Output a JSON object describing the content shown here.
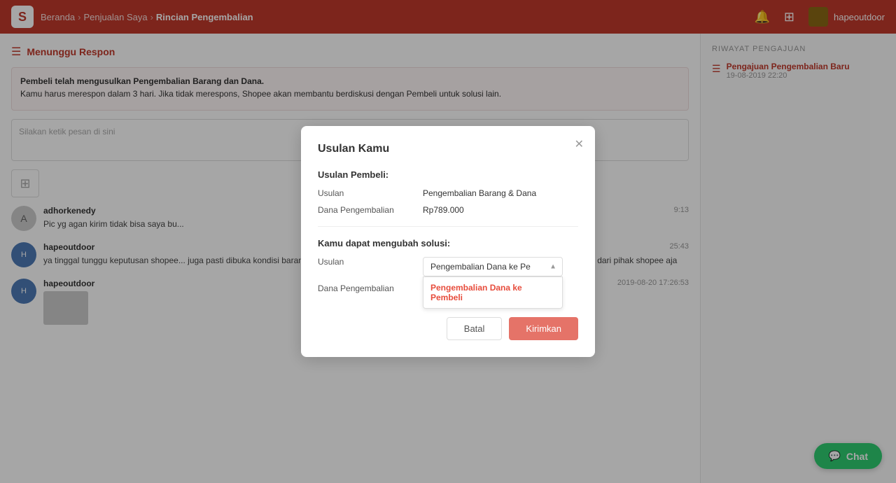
{
  "topnav": {
    "logo": "S",
    "breadcrumb": [
      {
        "label": "Beranda",
        "current": false
      },
      {
        "label": "Penjualan Saya",
        "current": false
      },
      {
        "label": "Rincian Pengembalian",
        "current": true
      }
    ],
    "user": "hapeoutdoor"
  },
  "left": {
    "status_icon": "☰",
    "status_title": "Menunggu Respon",
    "info_title": "Pembeli telah mengusulkan Pengembalian Barang dan Dana.",
    "info_body": "Kamu harus merespon dalam 3 hari. Jika tidak merespons, Shopee akan membantu berdiskusi dengan Pembeli untuk solusi lain.",
    "message_placeholder": "Silakan ketik pesan di sini",
    "comments": [
      {
        "author": "adhorkenedy",
        "time": "9:13",
        "text": "Pic yg agan kirim tidak bisa saya bu...",
        "has_image": false
      },
      {
        "author": "hapeoutdoor",
        "time": "25:43",
        "text": "ya tinggal tunggu keputusan shopee... juga pasti dibuka kondisi barang. em... malfungsi kok minta pengembalian barang dan dana. tunggu resolving dari pihak shopee aja",
        "has_image": false
      },
      {
        "author": "hapeoutdoor",
        "time": "2019-08-20 17:26:53",
        "text": "",
        "has_image": true
      }
    ]
  },
  "right": {
    "section_title": "RIWAYAT PENGAJUAN",
    "item_label": "Pengajuan Pengembalian Baru",
    "item_date": "19-08-2019 22:20"
  },
  "modal": {
    "title": "Usulan Kamu",
    "section_pembeli": "Usulan Pembeli:",
    "usulan_label": "Usulan",
    "usulan_value": "Pengembalian Barang & Dana",
    "dana_label": "Dana Pengembalian",
    "dana_value": "Rp789.000",
    "section_ubah": "Kamu dapat mengubah solusi:",
    "usulan2_label": "Usulan",
    "select_current": "Pengembalian Dana ke Pe",
    "dana2_label": "Dana Pengembalian",
    "dropdown_option": "Pengembalian Dana ke Pembeli",
    "btn_batal": "Batal",
    "btn_kirim": "Kirimkan"
  },
  "chat": {
    "label": "Chat",
    "icon": "💬"
  }
}
